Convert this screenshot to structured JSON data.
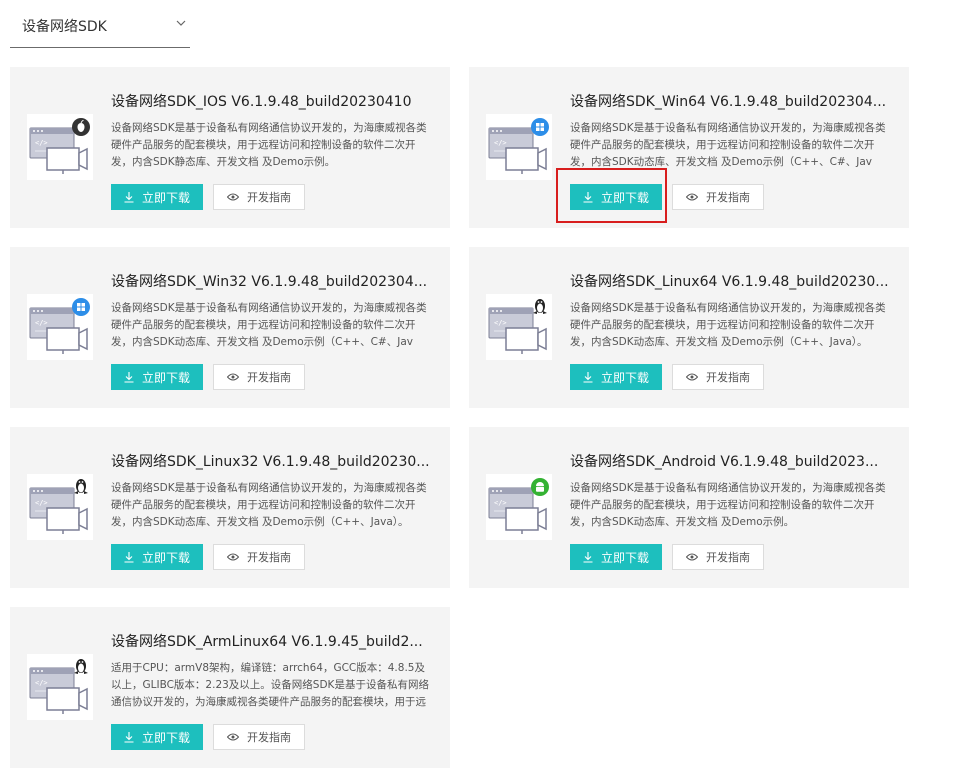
{
  "dropdown": {
    "selected": "设备网络SDK",
    "icon": "chevron-down-icon"
  },
  "colors": {
    "accent": "#1dbfbe",
    "card_bg": "#f4f4f4",
    "highlight": "#d81e1e"
  },
  "cards": [
    {
      "title": "设备网络SDK_IOS V6.1.9.48_build20230410",
      "desc": "设备网络SDK是基于设备私有网络通信协议开发的，为海康威视各类硬件产品服务的配套模块，用于远程访问和控制设备的软件二次开发，内含SDK静态库、开发文档 及Demo示例。",
      "platform_icon": "apple-icon",
      "download_label": "立即下载",
      "guide_label": "开发指南"
    },
    {
      "title": "设备网络SDK_Win64 V6.1.9.48_build202304...",
      "desc": "设备网络SDK是基于设备私有网络通信协议开发的，为海康威视各类硬件产品服务的配套模块，用于远程访问和控制设备的软件二次开发，内含SDK动态库、开发文档 及Demo示例（C++、C#、Jav",
      "platform_icon": "windows-icon",
      "download_label": "立即下载",
      "guide_label": "开发指南"
    },
    {
      "title": "设备网络SDK_Win32 V6.1.9.48_build202304...",
      "desc": "设备网络SDK是基于设备私有网络通信协议开发的，为海康威视各类硬件产品服务的配套模块，用于远程访问和控制设备的软件二次开发，内含SDK动态库、开发文档 及Demo示例（C++、C#、Jav",
      "platform_icon": "windows-icon",
      "download_label": "立即下载",
      "guide_label": "开发指南"
    },
    {
      "title": "设备网络SDK_Linux64 V6.1.9.48_build20230...",
      "desc": "设备网络SDK是基于设备私有网络通信协议开发的，为海康威视各类硬件产品服务的配套模块，用于远程访问和控制设备的软件二次开发，内含SDK动态库、开发文档 及Demo示例（C++、Java）。",
      "platform_icon": "linux-icon",
      "download_label": "立即下载",
      "guide_label": "开发指南"
    },
    {
      "title": "设备网络SDK_Linux32 V6.1.9.48_build20230...",
      "desc": "设备网络SDK是基于设备私有网络通信协议开发的，为海康威视各类硬件产品服务的配套模块，用于远程访问和控制设备的软件二次开发，内含SDK动态库、开发文档 及Demo示例（C++、Java）。",
      "platform_icon": "linux-icon",
      "download_label": "立即下载",
      "guide_label": "开发指南"
    },
    {
      "title": "设备网络SDK_Android V6.1.9.48_build2023...",
      "desc": "设备网络SDK是基于设备私有网络通信协议开发的，为海康威视各类硬件产品服务的配套模块，用于远程访问和控制设备的软件二次开发，内含SDK动态库、开发文档 及Demo示例。",
      "platform_icon": "android-icon",
      "download_label": "立即下载",
      "guide_label": "开发指南"
    },
    {
      "title": "设备网络SDK_ArmLinux64 V6.1.9.45_build2...",
      "desc": "适用于CPU：armV8架构，编译链：arrch64，GCC版本：4.8.5及以上，GLIBC版本：2.23及以上。设备网络SDK是基于设备私有网络通信协议开发的，为海康威视各类硬件产品服务的配套模块，用于远程",
      "platform_icon": "linux-icon",
      "download_label": "立即下载",
      "guide_label": "开发指南"
    }
  ]
}
